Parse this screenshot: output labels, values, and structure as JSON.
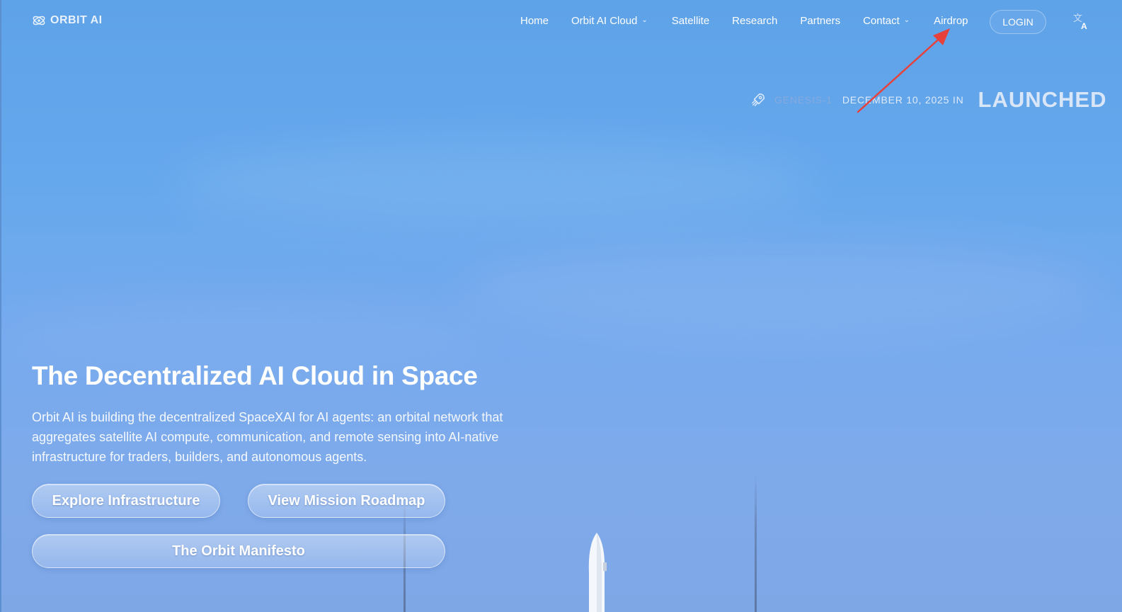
{
  "brand": {
    "name": "ORBIT AI",
    "logo_icon": "orbit-satellite-icon"
  },
  "nav": {
    "items": [
      {
        "label": "Home",
        "has_dropdown": false
      },
      {
        "label": "Orbit AI Cloud",
        "has_dropdown": true
      },
      {
        "label": "Satellite",
        "has_dropdown": false
      },
      {
        "label": "Research",
        "has_dropdown": false
      },
      {
        "label": "Partners",
        "has_dropdown": false
      },
      {
        "label": "Contact",
        "has_dropdown": true
      },
      {
        "label": "Airdrop",
        "has_dropdown": false
      }
    ],
    "login_label": "LOGIN",
    "language_icon": "translate-icon"
  },
  "status": {
    "icon": "rocket-icon",
    "label": "GENESIS-1",
    "date": "DECEMBER 10, 2025 IN",
    "state": "LAUNCHED"
  },
  "hero": {
    "title": "The Decentralized AI Cloud in Space",
    "description": "Orbit AI is building the decentralized SpaceXAI for AI agents: an orbital network that aggregates satellite AI compute, communication, and remote sensing into AI-native infrastructure for traders, builders, and autonomous agents.",
    "buttons": {
      "explore": "Explore Infrastructure",
      "roadmap": "View Mission Roadmap",
      "manifesto": "The Orbit Manifesto"
    }
  },
  "annotation": {
    "color": "#e8413c"
  }
}
